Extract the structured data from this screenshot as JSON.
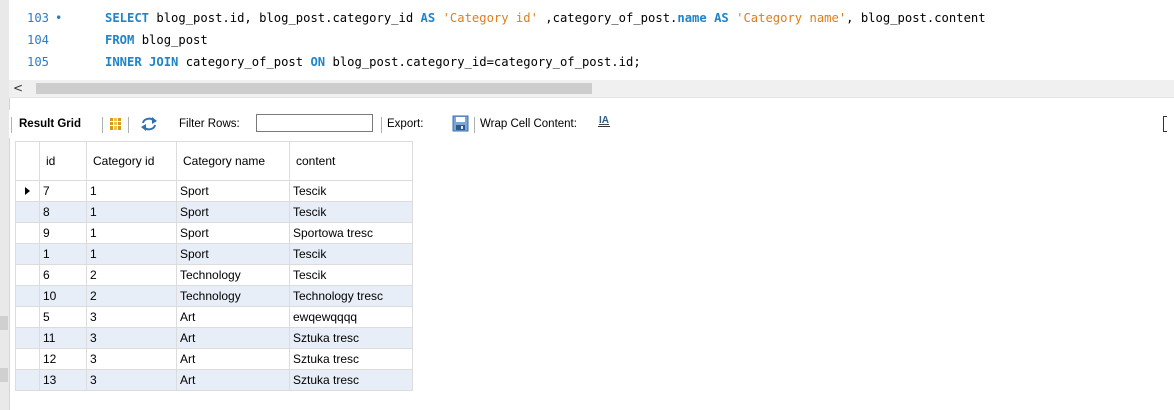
{
  "editor": {
    "lines": [
      {
        "number": "103",
        "has_marker": true,
        "tokens": [
          {
            "t": "SELECT",
            "k": "kw"
          },
          {
            "t": " blog_post.id, blog_post.category_id ",
            "k": ""
          },
          {
            "t": "AS",
            "k": "kw"
          },
          {
            "t": " ",
            "k": ""
          },
          {
            "t": "'Category id'",
            "k": "str"
          },
          {
            "t": " ,category_of_post.",
            "k": ""
          },
          {
            "t": "name",
            "k": "kw"
          },
          {
            "t": " ",
            "k": ""
          },
          {
            "t": "AS",
            "k": "kw"
          },
          {
            "t": " ",
            "k": ""
          },
          {
            "t": "'Category name'",
            "k": "str"
          },
          {
            "t": ", blog_post.content",
            "k": ""
          }
        ]
      },
      {
        "number": "104",
        "has_marker": false,
        "tokens": [
          {
            "t": "FROM",
            "k": "kw"
          },
          {
            "t": " blog_post",
            "k": ""
          }
        ]
      },
      {
        "number": "105",
        "has_marker": false,
        "tokens": [
          {
            "t": "INNER JOIN",
            "k": "kw"
          },
          {
            "t": " category_of_post ",
            "k": ""
          },
          {
            "t": "ON",
            "k": "kw"
          },
          {
            "t": " blog_post.category_id=category_of_post.id;",
            "k": ""
          }
        ]
      }
    ],
    "marker_glyph": "•",
    "scroll_left_glyph": "<"
  },
  "toolbar": {
    "result_grid_label": "Result Grid",
    "filter_rows_label": "Filter Rows:",
    "filter_value": "",
    "export_label": "Export:",
    "wrap_label": "Wrap Cell Content:",
    "wrap_icon_glyph": "IA",
    "icons": [
      "grid-icon",
      "refresh-icon",
      "export-icon",
      "wrap-icon"
    ]
  },
  "grid": {
    "columns": [
      "id",
      "Category id",
      "Category name",
      "content"
    ],
    "rows": [
      [
        "7",
        "1",
        "Sport",
        "Tescik"
      ],
      [
        "8",
        "1",
        "Sport",
        "Tescik"
      ],
      [
        "9",
        "1",
        "Sport",
        "Sportowa tresc"
      ],
      [
        "1",
        "1",
        "Sport",
        "Tescik"
      ],
      [
        "6",
        "2",
        "Technology",
        "Tescik"
      ],
      [
        "10",
        "2",
        "Technology",
        "Technology tresc"
      ],
      [
        "5",
        "3",
        "Art",
        "ewqewqqqq"
      ],
      [
        "11",
        "3",
        "Art",
        "Sztuka tresc"
      ],
      [
        "12",
        "3",
        "Art",
        "Sztuka tresc"
      ],
      [
        "13",
        "3",
        "Art",
        "Sztuka tresc"
      ]
    ],
    "current_row": 0
  },
  "colors": {
    "keyword": "#1f84c8",
    "string": "#e07d18",
    "line_number": "#2b7cc8",
    "alt_row": "#e8eef7"
  }
}
